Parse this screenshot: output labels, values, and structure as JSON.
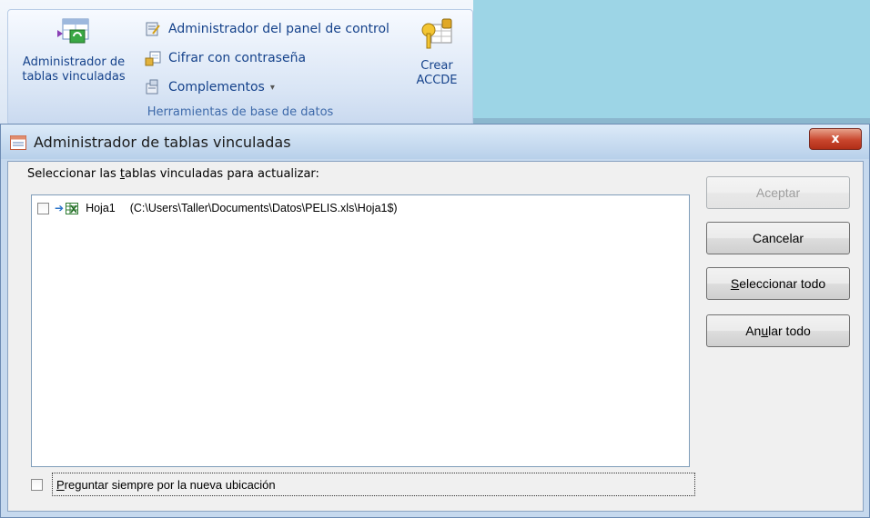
{
  "ribbon": {
    "big_button_left": {
      "line1": "Administrador de",
      "line2": "tablas vinculadas"
    },
    "small_buttons": [
      {
        "label": "Administrador del panel de control",
        "icon": "switchboard-icon"
      },
      {
        "label": "Cifrar con contraseña",
        "icon": "encrypt-icon"
      },
      {
        "label": "Complementos",
        "caret": "▾",
        "icon": "addins-icon"
      }
    ],
    "big_button_right": {
      "line1": "Crear",
      "line2": "ACCDE"
    },
    "group_label": "Herramientas de base de datos"
  },
  "dialog": {
    "title": "Administrador de tablas vinculadas",
    "close_label": "x",
    "prompt": {
      "pre": "Seleccionar las ",
      "accel": "t",
      "post": "ablas vinculadas para actualizar:"
    },
    "items": [
      {
        "name": "Hoja1",
        "path": "(C:\\Users\\Taller\\Documents\\Datos\\PELIS.xls\\Hoja1$)",
        "checked": false
      }
    ],
    "buttons": {
      "accept": "Aceptar",
      "cancel": "Cancelar",
      "select_all": {
        "accel": "S",
        "rest": "eleccionar todo"
      },
      "clear_all": {
        "pre": "An",
        "accel": "u",
        "post": "lar todo"
      }
    },
    "always_prompt": {
      "accel": "P",
      "rest": "reguntar siempre por la nueva ubicación"
    }
  },
  "colors": {
    "ribbon_text": "#15428b",
    "background_right": "#9ed6e6",
    "close_button": "#c9462d"
  }
}
